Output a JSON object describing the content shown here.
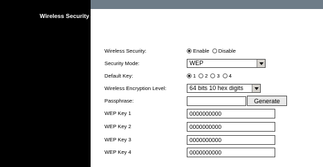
{
  "sidebar": {
    "section_title": "Wireless Security"
  },
  "form": {
    "wireless_security": {
      "label": "Wireless Security:",
      "options": [
        "Enable",
        "Disable"
      ],
      "selected": "Enable"
    },
    "security_mode": {
      "label": "Security Mode:",
      "value": "WEP"
    },
    "default_key": {
      "label": "Default Key:",
      "options": [
        "1",
        "2",
        "3",
        "4"
      ],
      "selected": "1"
    },
    "encryption_level": {
      "label": "Wireless Encryption Level:",
      "value": "64 bits 10 hex digits"
    },
    "passphrase": {
      "label": "Passphrase:",
      "value": "",
      "generate_label": "Generate"
    },
    "wep_keys": [
      {
        "label": "WEP Key 1",
        "value": "0000000000"
      },
      {
        "label": "WEP Key 2",
        "value": "0000000000"
      },
      {
        "label": "WEP Key 3",
        "value": "0000000000"
      },
      {
        "label": "WEP Key 4",
        "value": "0000000000"
      }
    ]
  },
  "colors": {
    "sidebar_bg": "#000000",
    "top_band": "#6e7c88",
    "panel_bg": "#ffffff"
  }
}
